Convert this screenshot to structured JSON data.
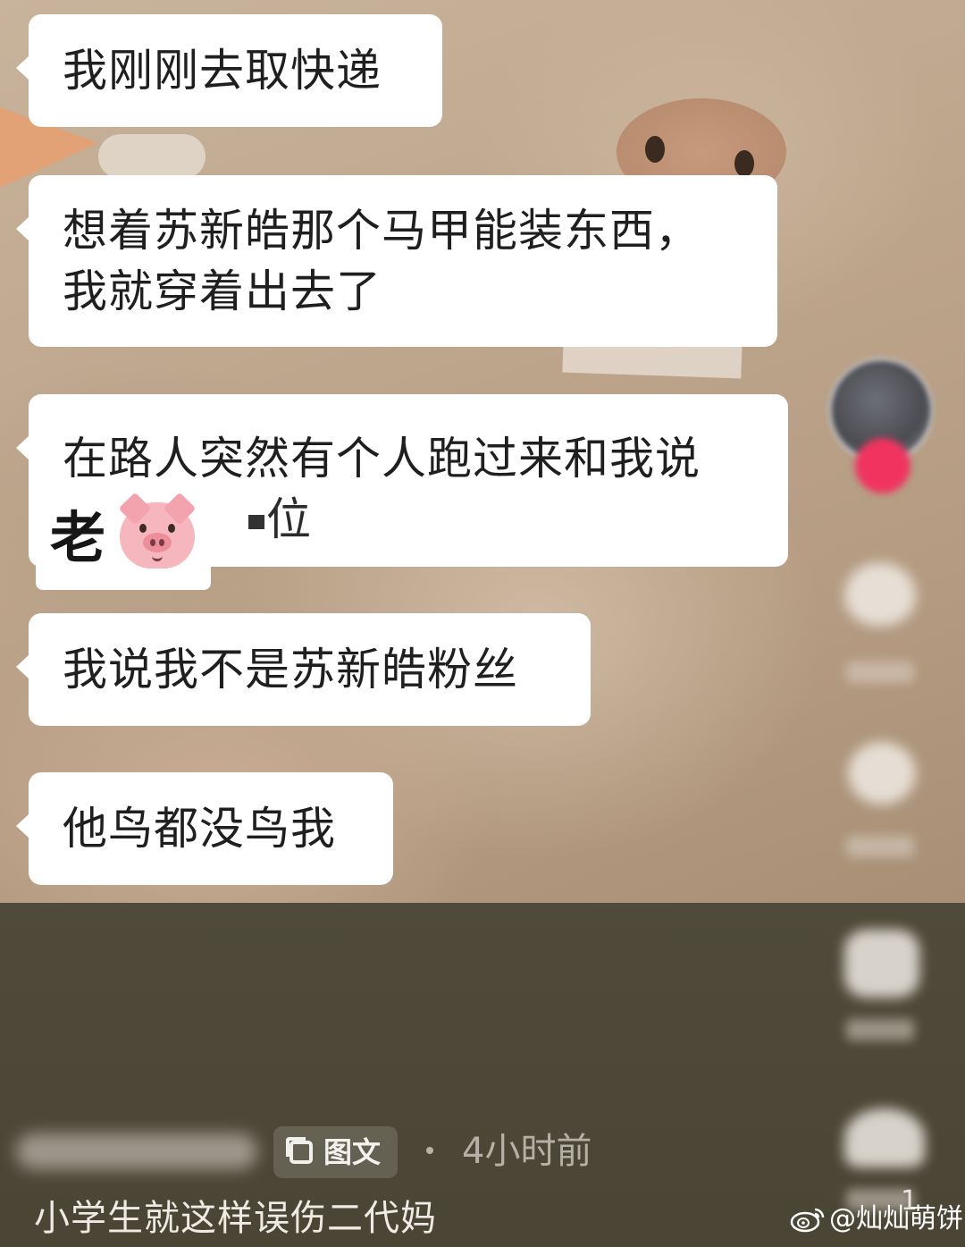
{
  "messages": [
    {
      "lines": [
        "我刚刚去取快递"
      ]
    },
    {
      "lines": [
        "想着苏新皓那个马甲能装东西，",
        "我就穿着出去了"
      ]
    },
    {
      "lines": [
        "在路人突然有个人跑过来和我说"
      ],
      "partial": "位"
    },
    {
      "lines": [
        "我说我不是苏新皓粉丝"
      ]
    },
    {
      "lines": [
        "他鸟都没鸟我"
      ]
    }
  ],
  "overlay": {
    "text": "老",
    "emoji": "pig-face"
  },
  "post": {
    "tag": "图文",
    "time": "4小时前",
    "caption": "小学生就这样误伤二代妈",
    "page_indicator": "1"
  },
  "watermark": "@灿灿萌饼",
  "colors": {
    "bubble": "#ffffff",
    "follow": "#f0345f",
    "panel": "#4a4535"
  }
}
